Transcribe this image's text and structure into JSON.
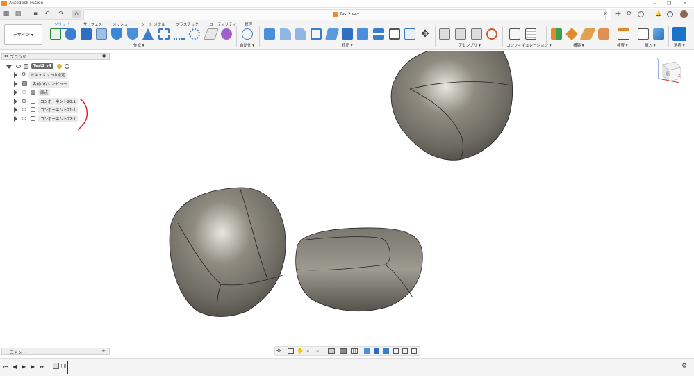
{
  "window": {
    "title": "Autodesk Fusion",
    "minimize": "–",
    "restore": "❐",
    "close": "✕"
  },
  "document": {
    "tab_title": "Test2 v4*",
    "close": "✕"
  },
  "quick_access": {
    "grid": "▦",
    "file": "▤",
    "save": "▪",
    "undo": "↶",
    "redo": "↷",
    "home": "⌂"
  },
  "right_tools": {
    "add": "+",
    "sync": "⟳",
    "count": "1",
    "bell": "🔔",
    "help": "?"
  },
  "workspace": {
    "label": "デザイン ▾"
  },
  "tabs": [
    "ソリッド",
    "サーフェス",
    "メッシュ",
    "シート メタル",
    "プラスチック",
    "ユーティリティ",
    "管理"
  ],
  "groups": [
    "作成 ▾",
    "自動化 ▾",
    "修正 ▾",
    "アセンブリ ▾",
    "コンフィギュレーション ▾",
    "構築 ▾",
    "検査 ▾",
    "挿入 ▾",
    "選択 ▾"
  ],
  "browser": {
    "title": "ブラウザ",
    "root": "Test2 v4",
    "items": [
      "ドキュメントの設定",
      "名前の付いたビュー",
      "原点",
      "コンポーネント20:1",
      "コンポーネント21:1",
      "コンポーネント22:1"
    ]
  },
  "comments": {
    "title": "コメント",
    "add": "+"
  },
  "timeline": {
    "settings": "⚙"
  },
  "viewcube": {
    "face": "前",
    "axis_z": "Z",
    "axis_x": "X"
  },
  "colors": {
    "accent": "#1a73c8",
    "brand": "#f08a24",
    "annotation": "#d22020",
    "model": "#7d7a72"
  }
}
